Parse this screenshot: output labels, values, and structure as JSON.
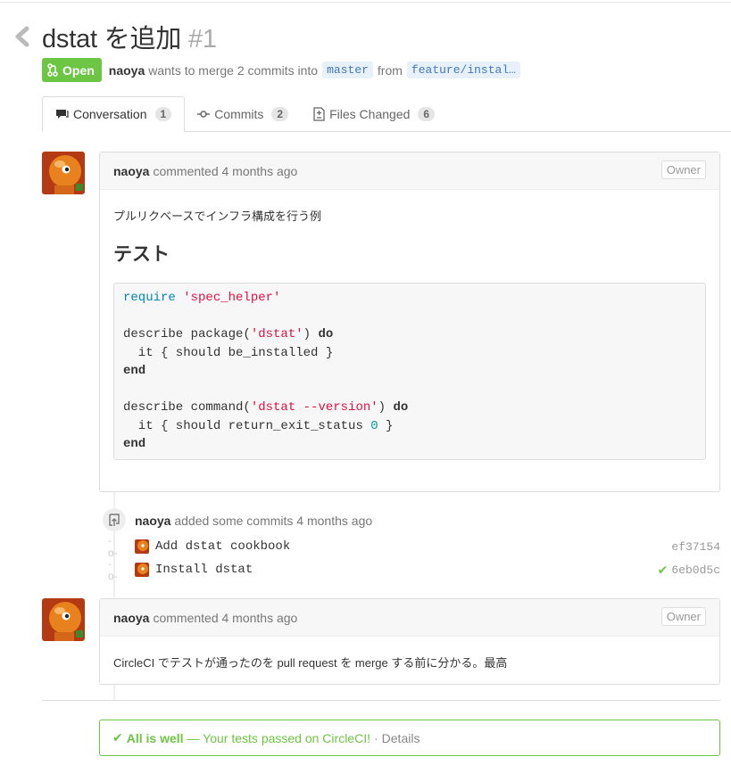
{
  "pull": {
    "title": "dstat を追加",
    "number": "#1",
    "state": "Open",
    "author": "naoya",
    "merge_text": "wants to merge 2 commits into",
    "base_branch": "master",
    "from_text": "from",
    "head_branch": "feature/instal…"
  },
  "tabs": [
    {
      "label": "Conversation",
      "count": "1",
      "icon": "comment-icon"
    },
    {
      "label": "Commits",
      "count": "2",
      "icon": "commit-icon"
    },
    {
      "label": "Files Changed",
      "count": "6",
      "icon": "file-diff-icon"
    }
  ],
  "comments": [
    {
      "author": "naoya",
      "action": "commented 4 months ago",
      "role": "Owner",
      "text": "プルリクベースでインフラ構成を行う例",
      "heading": "テスト",
      "code": {
        "l1_kw": "require",
        "l1_str": "'spec_helper'",
        "l3_a": "describe package(",
        "l3_str": "'dstat'",
        "l3_b": ") ",
        "l3_kw": "do",
        "l4": "  it { should be_installed }",
        "l5": "end",
        "l7_a": "describe command(",
        "l7_str": "'dstat --version'",
        "l7_b": ") ",
        "l7_kw": "do",
        "l8_a": "  it { should return_exit_status ",
        "l8_num": "0",
        "l8_b": " }",
        "l9": "end"
      }
    },
    {
      "author": "naoya",
      "action": "commented 4 months ago",
      "role": "Owner",
      "text": "CircleCI でテストが通ったのを pull request を merge する前に分かる。最高"
    }
  ],
  "commit_event": {
    "author": "naoya",
    "action": "added some commits 4 months ago",
    "commits": [
      {
        "message": "Add dstat cookbook",
        "sha": "ef37154",
        "status": ""
      },
      {
        "message": "Install dstat",
        "sha": "6eb0d5c",
        "status": "success"
      }
    ]
  },
  "ci_status": {
    "label": "All is well",
    "message": "— Your tests passed on CircleCI!",
    "separator": "·",
    "details": "Details"
  },
  "colors": {
    "open_green": "#6cc644",
    "link_blue": "#4078c0",
    "avatar_orange": "#e8821e"
  }
}
